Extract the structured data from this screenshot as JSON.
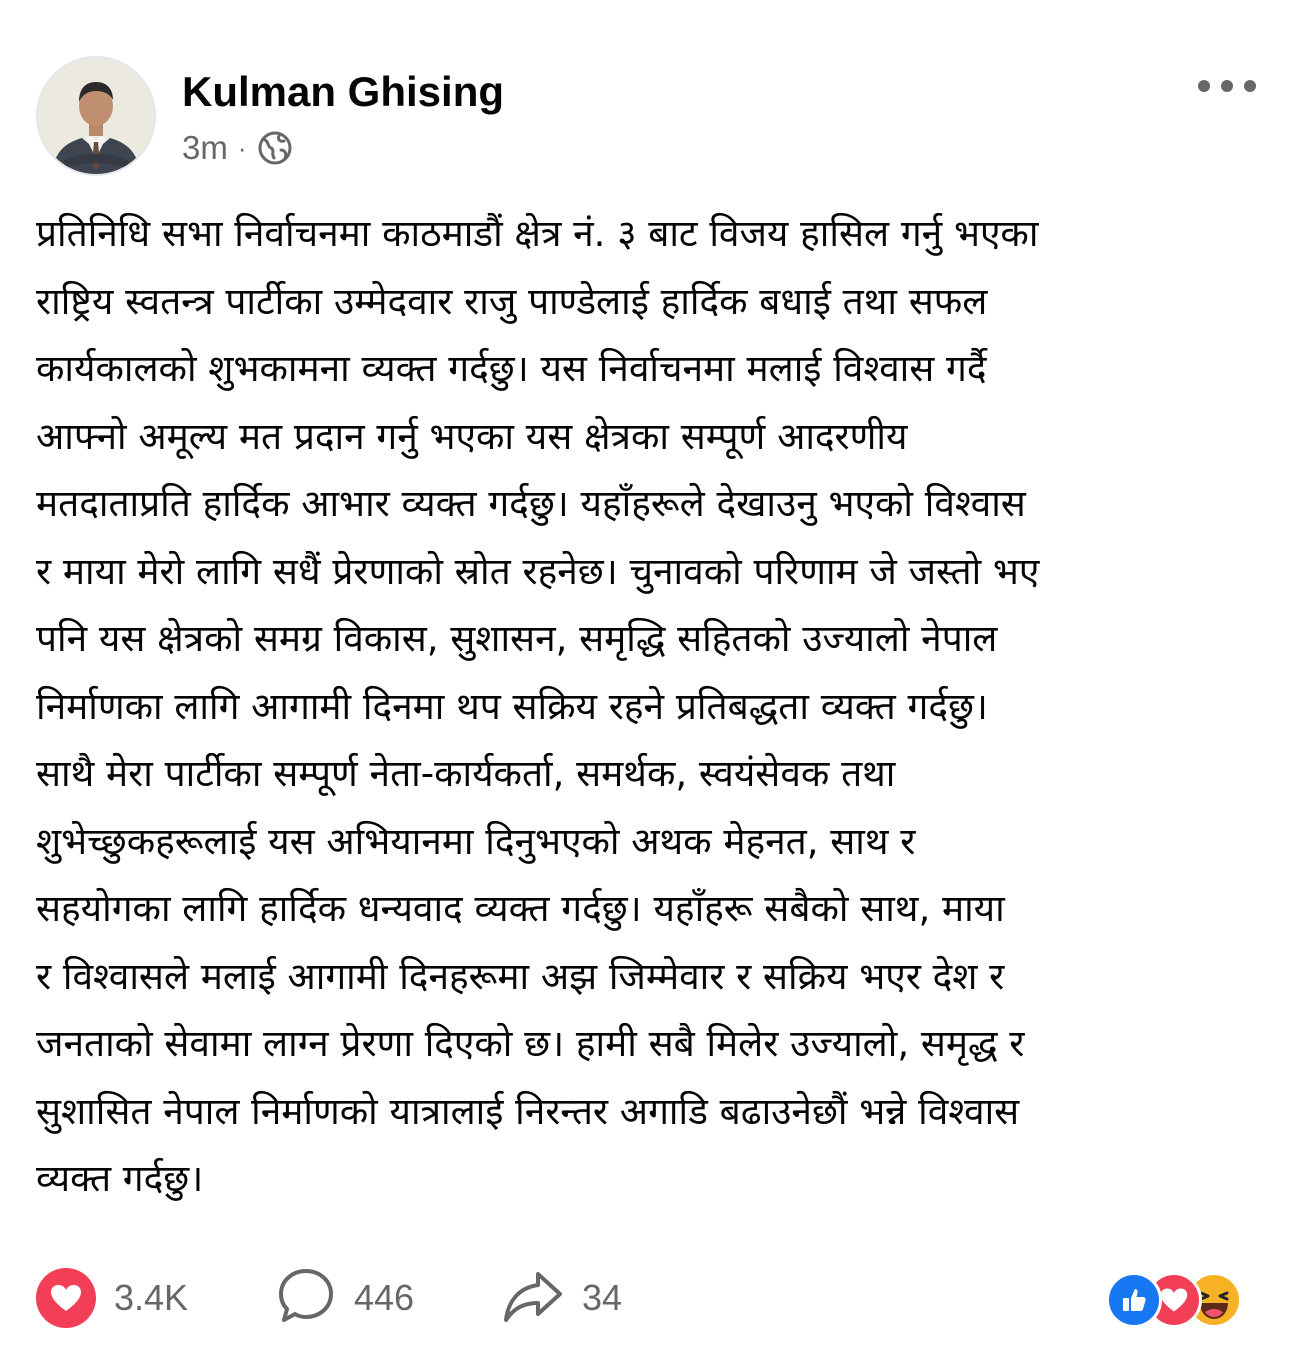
{
  "colors": {
    "text_primary": "#050505",
    "text_secondary": "#65676b",
    "love_red": "#f33e58",
    "like_blue": "#1877f2",
    "haha_yellow": "#f7b125"
  },
  "post": {
    "author": "Kulman Ghising",
    "time": "3m",
    "separator": "·",
    "privacy_icon": "globe-icon",
    "more_icon": "more-options-icon",
    "body_lines": [
      "प्रतिनिधि सभा निर्वाचनमा काठमाडौं क्षेत्र नं. ३ बाट विजय हासिल गर्नु भएका",
      "राष्ट्रिय स्वतन्त्र पार्टीका उम्मेदवार राजु पाण्डेलाई  हार्दिक बधाई तथा सफल",
      "कार्यकालको शुभकामना व्यक्त गर्दछु। यस निर्वाचनमा मलाई विश्वास गर्दै",
      "आफ्नो अमूल्य मत प्रदान गर्नु भएका यस क्षेत्रका सम्पूर्ण आदरणीय",
      "मतदाताप्रति हार्दिक आभार व्यक्त गर्दछु। यहाँहरूले देखाउनु भएको विश्वास",
      "र माया मेरो लागि सधैं प्रेरणाको स्रोत रहनेछ। चुनावको परिणाम जे जस्तो भए",
      "पनि यस क्षेत्रको समग्र विकास, सुशासन, समृद्धि  सहितको उज्यालो नेपाल",
      "निर्माणका लागि आगामी दिनमा थप सक्रिय रहने प्रतिबद्धता व्यक्त गर्दछु।",
      "साथै मेरा पार्टीका सम्पूर्ण नेता-कार्यकर्ता, समर्थक, स्वयंसेवक तथा",
      "शुभेच्छुकहरूलाई यस अभियानमा दिनुभएको अथक मेहनत, साथ र",
      "सहयोगका लागि हार्दिक धन्यवाद व्यक्त गर्दछु। यहाँहरू सबैको साथ, माया",
      "र विश्वासले मलाई आगामी दिनहरूमा अझ जिम्मेवार र सक्रिय भएर देश र",
      "जनताको सेवामा लाग्न प्रेरणा दिएको छ। हामी सबै मिलेर उज्यालो, समृद्ध र",
      "सुशासित नेपाल निर्माणको यात्रालाई निरन्तर अगाडि बढाउनेछौं भन्ने विश्वास",
      "व्यक्त गर्दछु।"
    ],
    "footer": {
      "likes": "3.4K",
      "like_icon": "heart-icon",
      "comments": "446",
      "comment_icon": "comment-icon",
      "shares": "34",
      "share_icon": "share-icon",
      "reaction_icons": [
        "like-reaction-icon",
        "love-reaction-icon",
        "haha-reaction-icon"
      ]
    }
  }
}
